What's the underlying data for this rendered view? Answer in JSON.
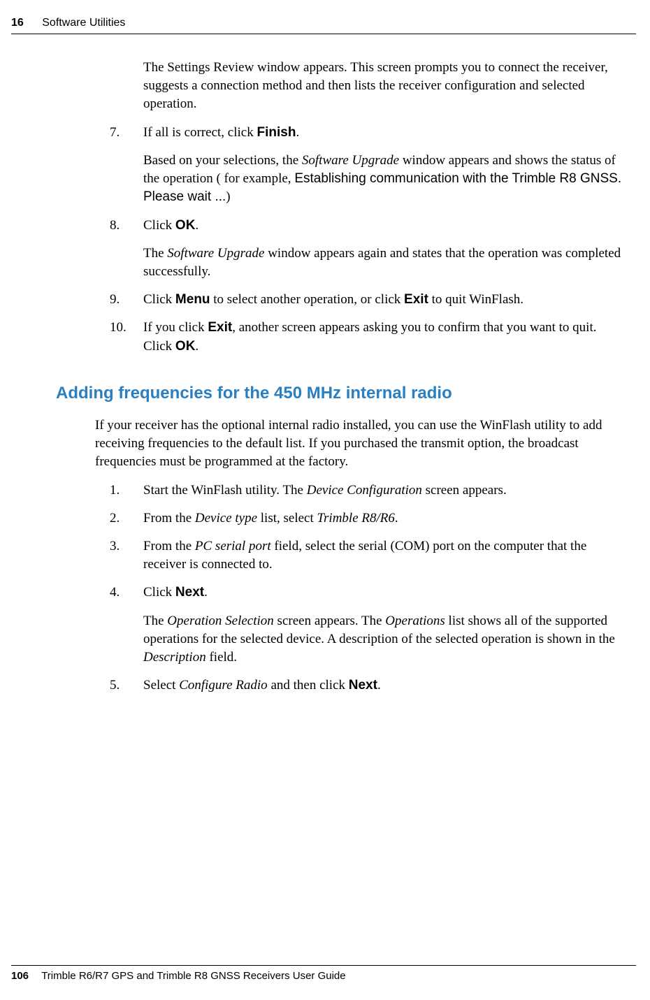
{
  "header": {
    "chapter_number": "16",
    "chapter_title": "Software Utilities"
  },
  "section1": {
    "cont_para": "The Settings Review window appears. This screen prompts you to connect the receiver, suggests a connection method and then lists the receiver configuration and selected operation.",
    "steps": [
      {
        "n": "7.",
        "pre": "If all is correct, click ",
        "b1": "Finish",
        "post": ".",
        "sub_pre": "Based on your selections, the ",
        "sub_i1": "Software Upgrade",
        "sub_mid": " window appears and shows the status of the operation ( for example, ",
        "sub_sans": "Establishing communication with the Trimble R8 GNSS. Please wait ...",
        "sub_post": ")"
      },
      {
        "n": "8.",
        "pre": "Click ",
        "b1": "OK",
        "post": ".",
        "sub_pre": "The ",
        "sub_i1": "Software Upgrade",
        "sub_post": " window appears again and states that the operation was completed successfully."
      },
      {
        "n": "9.",
        "pre": "Click ",
        "b1": "Menu",
        "mid": " to select another operation, or click ",
        "b2": "Exit",
        "post": " to quit WinFlash."
      },
      {
        "n": "10.",
        "pre": "If you click ",
        "b1": "Exit",
        "mid": ", another screen appears asking you to confirm that you want to quit. Click ",
        "b2": "OK",
        "post": "."
      }
    ]
  },
  "section2": {
    "heading": "Adding frequencies for the 450 MHz internal radio",
    "intro": "If your receiver has the optional internal radio installed, you can use the WinFlash utility to add receiving frequencies to the default list. If you purchased the transmit option, the broadcast frequencies must be programmed at the factory.",
    "steps": [
      {
        "n": "1.",
        "pre": "Start the WinFlash utility. The ",
        "i1": "Device Configuration",
        "post": " screen appears."
      },
      {
        "n": "2.",
        "pre": "From the ",
        "i1": "Device type",
        "mid": " list, select ",
        "i2": "Trimble R8/R6",
        "post": "."
      },
      {
        "n": "3.",
        "pre": "From the ",
        "i1": "PC serial port",
        "post": " field, select the serial (COM) port on the computer that the receiver is connected to."
      },
      {
        "n": "4.",
        "pre": "Click ",
        "b1": "Next",
        "post": ".",
        "sub_pre": "The ",
        "sub_i1": "Operation Selection",
        "sub_mid": " screen appears. The ",
        "sub_i2": "Operations",
        "sub_mid2": " list shows all of the supported operations for the selected device. A description of the selected operation is shown in the ",
        "sub_i3": "Description",
        "sub_post": " field."
      },
      {
        "n": "5.",
        "pre": "Select ",
        "i1": "Configure Radio",
        "mid": " and then click ",
        "b1": "Next",
        "post": "."
      }
    ]
  },
  "footer": {
    "page_number": "106",
    "guide_title": "Trimble R6/R7 GPS and Trimble R8 GNSS Receivers User Guide"
  }
}
